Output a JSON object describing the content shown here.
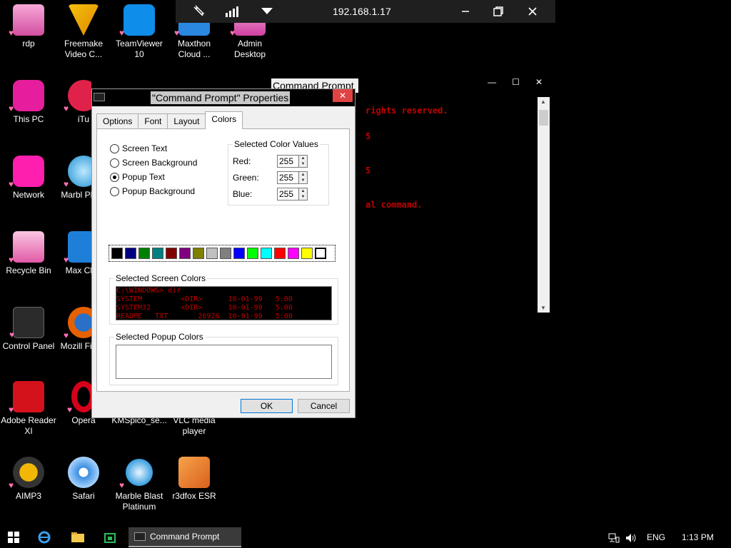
{
  "desktop": {
    "icons": [
      {
        "label": "rdp",
        "icon": "rdp-icon"
      },
      {
        "label": "Freemake Video C...",
        "icon": "freemake-icon"
      },
      {
        "label": "TeamViewer 10",
        "icon": "teamviewer-icon"
      },
      {
        "label": "Maxthon Cloud ...",
        "icon": "maxthon-icon"
      },
      {
        "label": "Admin Desktop",
        "icon": "admin-desktop-icon"
      },
      {
        "label": "This PC",
        "icon": "this-pc-icon"
      },
      {
        "label": "iTu",
        "icon": "itunes-icon"
      },
      {
        "label": "Network",
        "icon": "network-icon"
      },
      {
        "label": "Marbl Platin",
        "icon": "marble-icon"
      },
      {
        "label": "Recycle Bin",
        "icon": "recycle-bin-icon"
      },
      {
        "label": "Max Clou",
        "icon": "maxthon-icon"
      },
      {
        "label": "Control Panel",
        "icon": "control-panel-icon"
      },
      {
        "label": "Mozill Firefo",
        "icon": "firefox-icon"
      },
      {
        "label": "Adobe Reader XI",
        "icon": "adobe-reader-icon"
      },
      {
        "label": "Opera",
        "icon": "opera-icon"
      },
      {
        "label": "KMSpico_se...",
        "icon": "kmspico-icon"
      },
      {
        "label": "VLC media player",
        "icon": "vlc-icon"
      },
      {
        "label": "AIMP3",
        "icon": "aimp-icon"
      },
      {
        "label": "Safari",
        "icon": "safari-icon"
      },
      {
        "label": "Marble Blast Platinum",
        "icon": "marble-blast-icon"
      },
      {
        "label": "r3dfox ESR",
        "icon": "r3dfox-icon"
      }
    ]
  },
  "rdp_bar": {
    "title": "192.168.1.17",
    "icons": [
      "unpin-icon",
      "signal-icon",
      "dropdown-icon",
      "minimize-icon",
      "restore-icon",
      "close-icon"
    ]
  },
  "cmd_window": {
    "title": "Command Prompt",
    "lines": [
      "rights reserved.",
      "5",
      "5",
      "al command."
    ]
  },
  "dialog": {
    "title": "\"Command Prompt\" Properties",
    "close": "✕",
    "tabs": [
      "Options",
      "Font",
      "Layout",
      "Colors"
    ],
    "active_tab": "Colors",
    "radios": [
      {
        "label": "Screen Text",
        "selected": false
      },
      {
        "label": "Screen Background",
        "selected": false
      },
      {
        "label": "Popup Text",
        "selected": true
      },
      {
        "label": "Popup Background",
        "selected": false
      }
    ],
    "color_values": {
      "legend": "Selected Color Values",
      "red_label": "Red:",
      "red": "255",
      "green_label": "Green:",
      "green": "255",
      "blue_label": "Blue:",
      "blue": "255"
    },
    "palette": [
      "#000000",
      "#000080",
      "#008000",
      "#008080",
      "#800000",
      "#800080",
      "#808000",
      "#c0c0c0",
      "#808080",
      "#0000ff",
      "#00ff00",
      "#00ffff",
      "#ff0000",
      "#ff00ff",
      "#ffff00",
      "#ffffff"
    ],
    "selected_swatch": 15,
    "screen_colors": {
      "legend": "Selected Screen Colors",
      "lines": [
        "C:\\WINDOWS> dir",
        "SYSTEM         <DIR>      10-01-99   5:00",
        "SYSTEM32       <DIR>      10-01-99   5:00",
        "README   TXT       26926  10-01-99   5:00"
      ],
      "text_color": "#c00000",
      "bg_color": "#000000"
    },
    "popup_colors": {
      "legend": "Selected Popup Colors"
    },
    "ok": "OK",
    "cancel": "Cancel"
  },
  "taskbar": {
    "active_app": "Command Prompt",
    "lang": "ENG",
    "time": "1:13 PM"
  }
}
